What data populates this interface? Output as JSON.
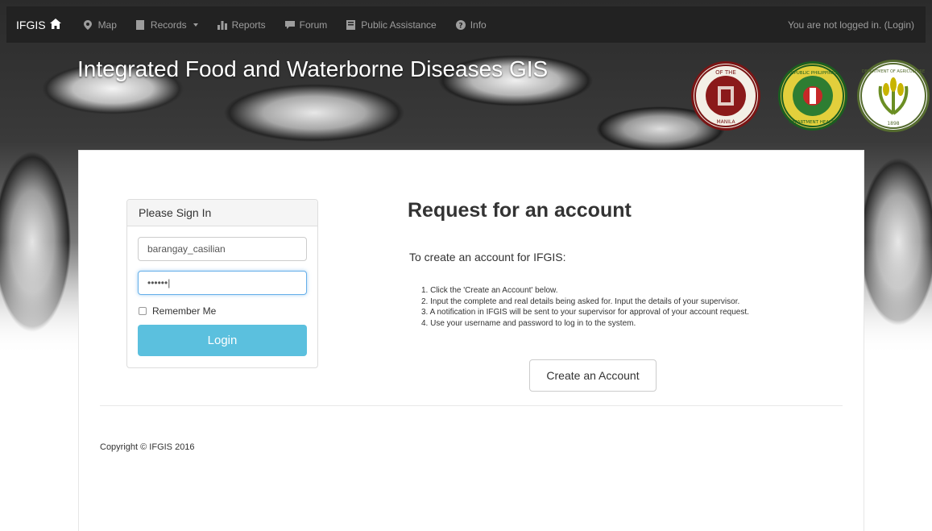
{
  "navbar": {
    "brand": "IFGIS",
    "items": [
      {
        "label": "Map",
        "icon": "map-marker-icon"
      },
      {
        "label": "Records",
        "icon": "file-icon",
        "dropdown": true
      },
      {
        "label": "Reports",
        "icon": "bar-chart-icon"
      },
      {
        "label": "Forum",
        "icon": "comment-icon"
      },
      {
        "label": "Public Assistance",
        "icon": "book-icon"
      },
      {
        "label": "Info",
        "icon": "question-circle-icon"
      }
    ],
    "login_status": "You are not logged in. (Login)"
  },
  "header": {
    "title": "Integrated Food and Waterborne Diseases GIS",
    "seals": [
      {
        "name": "university-of-the-philippines-manila-seal",
        "color": "#8b1a1a",
        "text_top": "OF THE",
        "text_bottom": "MANILA"
      },
      {
        "name": "department-of-health-seal",
        "color": "#2e7d32",
        "text_top": "REPUBLIC PHILIPPINES",
        "text_bottom": "DEPARTMENT HEALTH"
      },
      {
        "name": "department-of-agriculture-seal",
        "color": "#6b8e23",
        "text_top": "DEPARTMENT OF AGRICULTURE",
        "text_bottom": "1898"
      }
    ]
  },
  "login": {
    "heading": "Please Sign In",
    "username_value": "barangay_casilian",
    "password_value": "••••••|",
    "remember_label": "Remember Me",
    "login_button": "Login"
  },
  "request": {
    "title": "Request for an account",
    "subtitle": "To create an account for IFGIS:",
    "steps": [
      "1. Click the 'Create an Account' below.",
      "2. Input the complete and real details being asked for. Input the details of your supervisor.",
      "3. A notification in IFGIS will be sent to your supervisor for approval of your account request.",
      "4. Use your username and password to log in to the system."
    ],
    "create_button": "Create an Account"
  },
  "footer": {
    "copyright": "Copyright © IFGIS 2016"
  }
}
